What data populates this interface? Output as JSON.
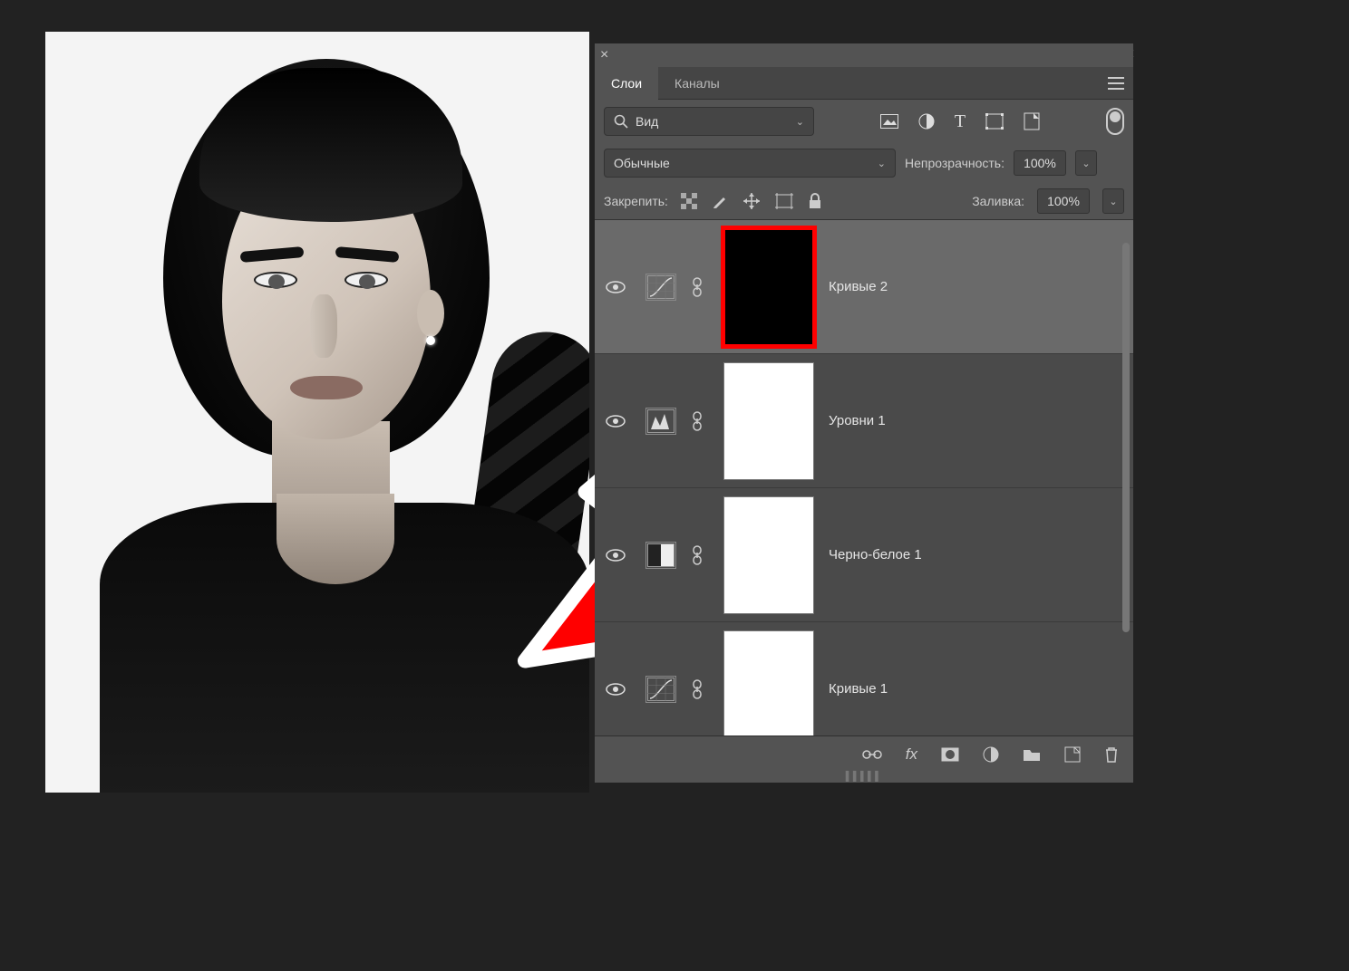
{
  "tabs": {
    "layers": "Слои",
    "channels": "Каналы"
  },
  "filter": {
    "label": "Вид",
    "placeholder": "Вид"
  },
  "filter_icons": [
    "image-icon",
    "adjust-icon",
    "type-icon",
    "shape-icon",
    "smartobj-icon"
  ],
  "blend": {
    "mode": "Обычные"
  },
  "opacity": {
    "label": "Непрозрачность:",
    "value": "100%"
  },
  "lock": {
    "label": "Закрепить:"
  },
  "fill": {
    "label": "Заливка:",
    "value": "100%"
  },
  "layers": [
    {
      "name": "Кривые 2",
      "adjust": "curves",
      "mask": "black",
      "selected": true,
      "maskSelected": true
    },
    {
      "name": "Уровни 1",
      "adjust": "levels",
      "mask": "white",
      "selected": false,
      "maskSelected": false
    },
    {
      "name": "Черно-белое 1",
      "adjust": "bw",
      "mask": "white",
      "selected": false,
      "maskSelected": false
    },
    {
      "name": "Кривые 1",
      "adjust": "curves",
      "mask": "white",
      "selected": false,
      "maskSelected": false
    }
  ],
  "footer_icons": [
    "link-icon",
    "fx-icon",
    "mask-icon",
    "adjustment-icon",
    "group-icon",
    "new-icon",
    "trash-icon"
  ]
}
